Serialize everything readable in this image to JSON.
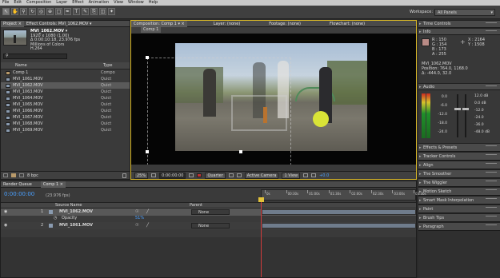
{
  "menu": [
    "File",
    "Edit",
    "Composition",
    "Layer",
    "Effect",
    "Animation",
    "View",
    "Window",
    "Help"
  ],
  "workspace": {
    "label": "Workspace:",
    "value": "All Panels"
  },
  "project": {
    "tabs": [
      "Project ×",
      "Effect Controls: MVI_1062.MOV ▾"
    ],
    "file_name": "MVI_1062.MOV ▾",
    "file_info": [
      "1920 x 1080 (1.00)",
      "Δ 0:00:10:18, 23.976 fps",
      "Millions of Colors",
      "H.264"
    ],
    "col_name": "Name",
    "col_type": "Type",
    "items": [
      {
        "name": "Comp 1",
        "type": "Compo",
        "kind": "comp"
      },
      {
        "name": "MVI_1061.MOV",
        "type": "Quict",
        "kind": "file"
      },
      {
        "name": "MVI_1062.MOV",
        "type": "Quict",
        "kind": "file"
      },
      {
        "name": "MVI_1063.MOV",
        "type": "Quict",
        "kind": "file"
      },
      {
        "name": "MVI_1064.MOV",
        "type": "Quict",
        "kind": "file"
      },
      {
        "name": "MVI_1065.MOV",
        "type": "Quict",
        "kind": "file"
      },
      {
        "name": "MVI_1066.MOV",
        "type": "Quict",
        "kind": "file"
      },
      {
        "name": "MVI_1067.MOV",
        "type": "Quict",
        "kind": "file"
      },
      {
        "name": "MVI_1068.MOV",
        "type": "Quict",
        "kind": "file"
      },
      {
        "name": "MVI_1069.MOV",
        "type": "Quict",
        "kind": "file"
      }
    ],
    "bpc": "8 bpc"
  },
  "comp_viewer": {
    "tabs": [
      "Composition: Comp 1 ▾ ×",
      "Layer: (none)",
      "Footage: (none)",
      "Flowchart: (none)"
    ],
    "tab_label": "Comp 1",
    "zoom": "25%",
    "timecode": "0:00:00:00",
    "resolution": "Quarter",
    "camera": "Active Camera",
    "views": "1 View",
    "exposure": "+0.0"
  },
  "timeline": {
    "tabs": [
      "Render Queue",
      "Comp 1 ×"
    ],
    "timecode": "0:00:00:00",
    "fps": "(23.976 fps)",
    "col_source": "Source Name",
    "col_parent": "Parent",
    "layers": [
      {
        "num": "1",
        "name": "MVI_1062.MOV",
        "parent": "None"
      },
      {
        "num": "2",
        "name": "MVI_1061.MOV",
        "parent": "None"
      }
    ],
    "opacity_label": "Opacity",
    "opacity_value": "51%",
    "ruler": [
      "0s",
      "00:30s",
      "01:00s",
      "01:30s",
      "02:00s",
      "02:30s",
      "03:00s",
      "03:30s"
    ]
  },
  "right_panels": {
    "time_controls": "Time Controls",
    "info": {
      "title": "Info",
      "rgb": [
        "R : 150",
        "G : 154",
        "B : 173",
        "A : 255"
      ],
      "xy": [
        "X : 2164",
        "Y : 1508"
      ],
      "layer": "MVI_1062.MOV",
      "position": "Position: 764.0, 1168.0",
      "delta": "Δ: -444.0, 32.0"
    },
    "audio": {
      "title": "Audio",
      "left_scale": [
        "0.0",
        "-6.0",
        "-12.0",
        "-18.0",
        "-24.0"
      ],
      "right_scale": [
        "12.0 dB",
        "0.0 dB",
        "-12.0",
        "-24.0",
        "-36.0",
        "-48.0 dB"
      ]
    },
    "panels": [
      "Effects & Presets",
      "Tracker Controls",
      "Align",
      "The Smoother",
      "The Wiggler",
      "Motion Sketch",
      "Smart Mask Interpolation",
      "Paint",
      "Brush Tips",
      "Paragraph"
    ]
  },
  "colors": {
    "accent": "#e8c22a",
    "timecode": "#4aa0ff",
    "selected_row": "#5a5a5a",
    "playhead": "#d23b3b"
  }
}
